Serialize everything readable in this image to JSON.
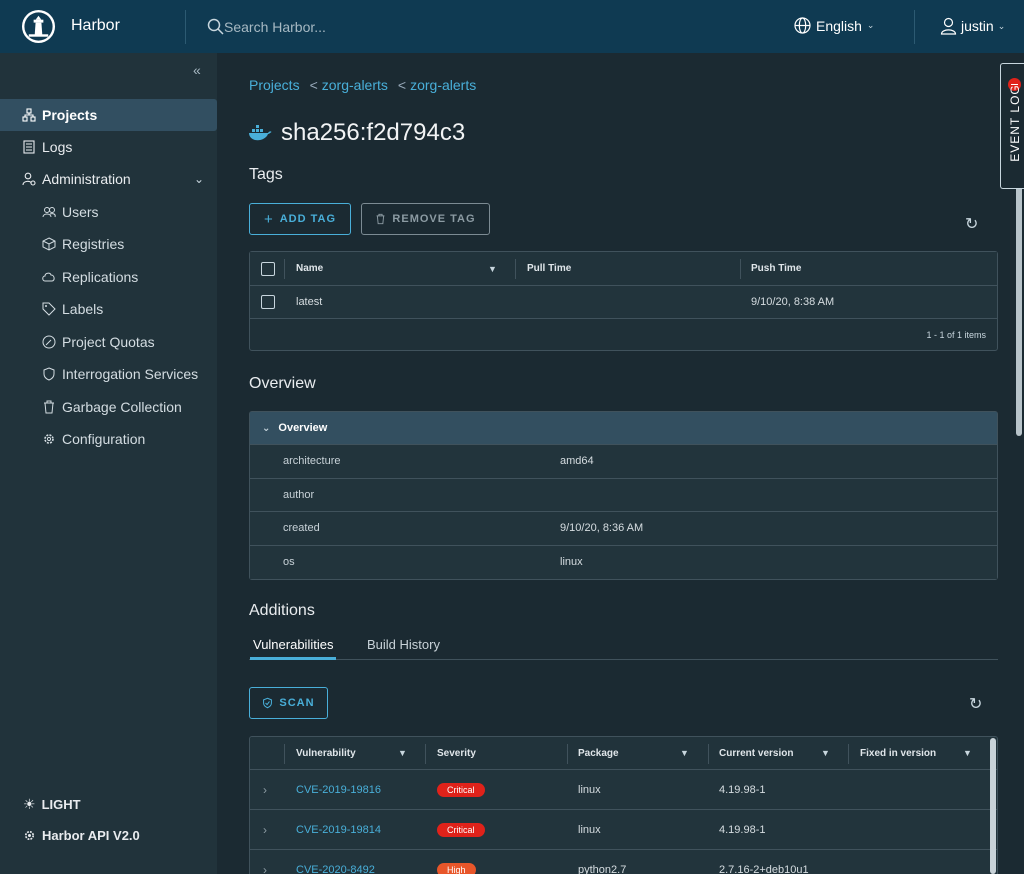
{
  "header": {
    "brand": "Harbor",
    "search_placeholder": "Search Harbor...",
    "language": "English",
    "user": "justin"
  },
  "sidebar": {
    "items": [
      {
        "label": "Projects",
        "icon": "projects-icon",
        "active": true
      },
      {
        "label": "Logs",
        "icon": "logs-icon"
      },
      {
        "label": "Administration",
        "icon": "administration-icon"
      }
    ],
    "admin_items": [
      {
        "label": "Users",
        "icon": "users-icon"
      },
      {
        "label": "Registries",
        "icon": "registries-icon"
      },
      {
        "label": "Replications",
        "icon": "replications-icon"
      },
      {
        "label": "Labels",
        "icon": "labels-icon"
      },
      {
        "label": "Project Quotas",
        "icon": "quotas-icon"
      },
      {
        "label": "Interrogation Services",
        "icon": "shield-icon"
      },
      {
        "label": "Garbage Collection",
        "icon": "trash-icon"
      },
      {
        "label": "Configuration",
        "icon": "gear-icon"
      }
    ],
    "theme_toggle": "LIGHT",
    "api_link": "Harbor API V2.0"
  },
  "breadcrumb": [
    "Projects",
    "zorg-alerts",
    "zorg-alerts"
  ],
  "artifact_title": "sha256:f2d794c3",
  "tags": {
    "heading": "Tags",
    "add_label": "ADD TAG",
    "remove_label": "REMOVE TAG",
    "columns": [
      "Name",
      "Pull Time",
      "Push Time"
    ],
    "rows": [
      {
        "name": "latest",
        "pull_time": "",
        "push_time": "9/10/20, 8:38 AM"
      }
    ],
    "footer": "1 - 1 of 1 items"
  },
  "overview": {
    "heading": "Overview",
    "panel_title": "Overview",
    "rows": [
      {
        "key": "architecture",
        "value": "amd64"
      },
      {
        "key": "author",
        "value": ""
      },
      {
        "key": "created",
        "value": "9/10/20, 8:36 AM"
      },
      {
        "key": "os",
        "value": "linux"
      }
    ]
  },
  "additions": {
    "heading": "Additions",
    "tabs": [
      "Vulnerabilities",
      "Build History"
    ],
    "scan_label": "SCAN",
    "columns": [
      "Vulnerability",
      "Severity",
      "Package",
      "Current version",
      "Fixed in version"
    ],
    "rows": [
      {
        "id": "CVE-2019-19816",
        "severity": "Critical",
        "package": "linux",
        "version": "4.19.98-1",
        "fixed": ""
      },
      {
        "id": "CVE-2019-19814",
        "severity": "Critical",
        "package": "linux",
        "version": "4.19.98-1",
        "fixed": ""
      },
      {
        "id": "CVE-2020-8492",
        "severity": "High",
        "package": "python2.7",
        "version": "2.7.16-2+deb10u1",
        "fixed": ""
      }
    ]
  },
  "event_log": "EVENT LOG",
  "colors": {
    "accent": "#49afd9",
    "header_bg": "#0f3a52",
    "critical": "#e0221a",
    "high": "#e8562a"
  }
}
